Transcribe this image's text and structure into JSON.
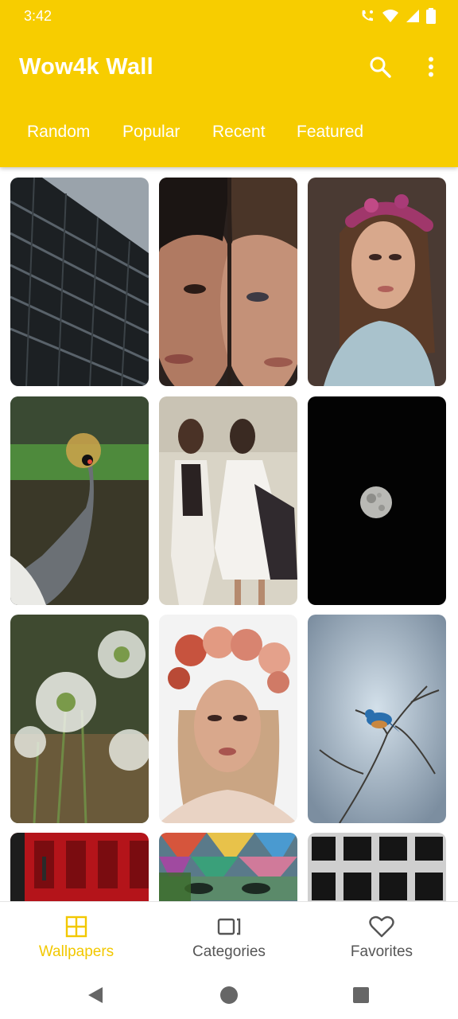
{
  "status_bar": {
    "time": "3:42"
  },
  "app_bar": {
    "title": "Wow4k Wall",
    "search_icon": "search-icon",
    "more_icon": "more-vert-icon"
  },
  "tabs": [
    {
      "label": "Random"
    },
    {
      "label": "Popular"
    },
    {
      "label": "Recent"
    },
    {
      "label": "Featured"
    }
  ],
  "wallpapers": [
    {
      "subject": "building"
    },
    {
      "subject": "two-faces"
    },
    {
      "subject": "flower-crown-woman"
    },
    {
      "subject": "crowned-crane"
    },
    {
      "subject": "two-women-dresses"
    },
    {
      "subject": "moon"
    },
    {
      "subject": "white-flowers"
    },
    {
      "subject": "rose-crown-woman"
    },
    {
      "subject": "bird-on-branch"
    },
    {
      "subject": "red-facade"
    },
    {
      "subject": "graffiti-face"
    },
    {
      "subject": "grey-facade"
    }
  ],
  "bottom_nav": [
    {
      "label": "Wallpapers",
      "icon": "grid-icon",
      "active": true
    },
    {
      "label": "Categories",
      "icon": "categories-icon",
      "active": false
    },
    {
      "label": "Favorites",
      "icon": "heart-icon",
      "active": false
    }
  ],
  "colors": {
    "accent": "#f7cd00",
    "active_nav": "#f2c800",
    "inactive_nav": "#555555"
  }
}
